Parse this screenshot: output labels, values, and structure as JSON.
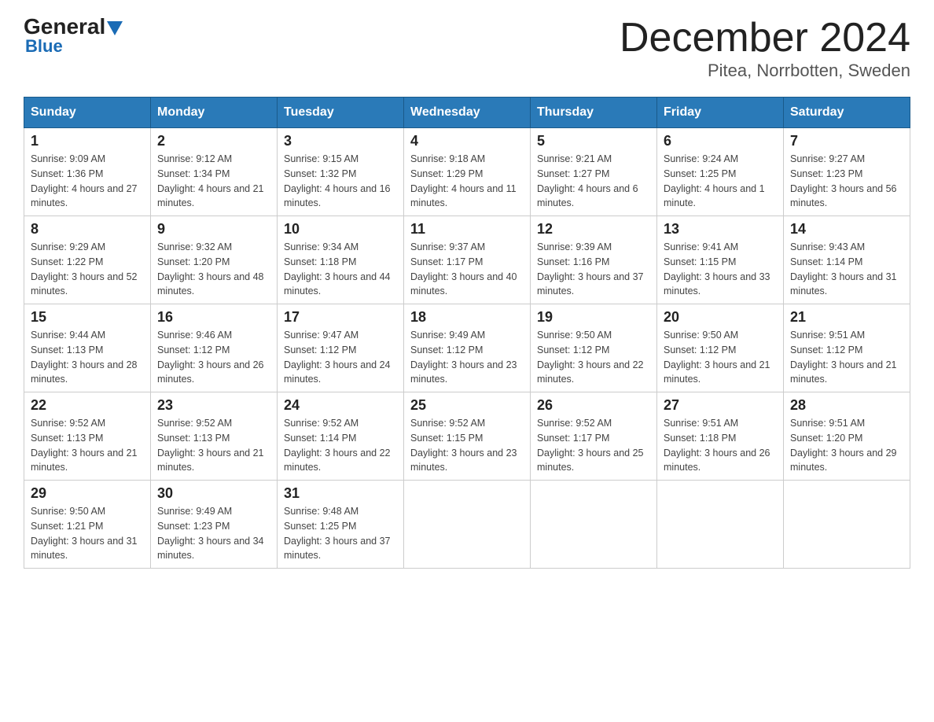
{
  "header": {
    "logo_general": "General",
    "logo_blue": "Blue",
    "main_title": "December 2024",
    "subtitle": "Pitea, Norrbotten, Sweden"
  },
  "days_of_week": [
    "Sunday",
    "Monday",
    "Tuesday",
    "Wednesday",
    "Thursday",
    "Friday",
    "Saturday"
  ],
  "weeks": [
    [
      {
        "day": "1",
        "sunrise": "9:09 AM",
        "sunset": "1:36 PM",
        "daylight": "4 hours and 27 minutes."
      },
      {
        "day": "2",
        "sunrise": "9:12 AM",
        "sunset": "1:34 PM",
        "daylight": "4 hours and 21 minutes."
      },
      {
        "day": "3",
        "sunrise": "9:15 AM",
        "sunset": "1:32 PM",
        "daylight": "4 hours and 16 minutes."
      },
      {
        "day": "4",
        "sunrise": "9:18 AM",
        "sunset": "1:29 PM",
        "daylight": "4 hours and 11 minutes."
      },
      {
        "day": "5",
        "sunrise": "9:21 AM",
        "sunset": "1:27 PM",
        "daylight": "4 hours and 6 minutes."
      },
      {
        "day": "6",
        "sunrise": "9:24 AM",
        "sunset": "1:25 PM",
        "daylight": "4 hours and 1 minute."
      },
      {
        "day": "7",
        "sunrise": "9:27 AM",
        "sunset": "1:23 PM",
        "daylight": "3 hours and 56 minutes."
      }
    ],
    [
      {
        "day": "8",
        "sunrise": "9:29 AM",
        "sunset": "1:22 PM",
        "daylight": "3 hours and 52 minutes."
      },
      {
        "day": "9",
        "sunrise": "9:32 AM",
        "sunset": "1:20 PM",
        "daylight": "3 hours and 48 minutes."
      },
      {
        "day": "10",
        "sunrise": "9:34 AM",
        "sunset": "1:18 PM",
        "daylight": "3 hours and 44 minutes."
      },
      {
        "day": "11",
        "sunrise": "9:37 AM",
        "sunset": "1:17 PM",
        "daylight": "3 hours and 40 minutes."
      },
      {
        "day": "12",
        "sunrise": "9:39 AM",
        "sunset": "1:16 PM",
        "daylight": "3 hours and 37 minutes."
      },
      {
        "day": "13",
        "sunrise": "9:41 AM",
        "sunset": "1:15 PM",
        "daylight": "3 hours and 33 minutes."
      },
      {
        "day": "14",
        "sunrise": "9:43 AM",
        "sunset": "1:14 PM",
        "daylight": "3 hours and 31 minutes."
      }
    ],
    [
      {
        "day": "15",
        "sunrise": "9:44 AM",
        "sunset": "1:13 PM",
        "daylight": "3 hours and 28 minutes."
      },
      {
        "day": "16",
        "sunrise": "9:46 AM",
        "sunset": "1:12 PM",
        "daylight": "3 hours and 26 minutes."
      },
      {
        "day": "17",
        "sunrise": "9:47 AM",
        "sunset": "1:12 PM",
        "daylight": "3 hours and 24 minutes."
      },
      {
        "day": "18",
        "sunrise": "9:49 AM",
        "sunset": "1:12 PM",
        "daylight": "3 hours and 23 minutes."
      },
      {
        "day": "19",
        "sunrise": "9:50 AM",
        "sunset": "1:12 PM",
        "daylight": "3 hours and 22 minutes."
      },
      {
        "day": "20",
        "sunrise": "9:50 AM",
        "sunset": "1:12 PM",
        "daylight": "3 hours and 21 minutes."
      },
      {
        "day": "21",
        "sunrise": "9:51 AM",
        "sunset": "1:12 PM",
        "daylight": "3 hours and 21 minutes."
      }
    ],
    [
      {
        "day": "22",
        "sunrise": "9:52 AM",
        "sunset": "1:13 PM",
        "daylight": "3 hours and 21 minutes."
      },
      {
        "day": "23",
        "sunrise": "9:52 AM",
        "sunset": "1:13 PM",
        "daylight": "3 hours and 21 minutes."
      },
      {
        "day": "24",
        "sunrise": "9:52 AM",
        "sunset": "1:14 PM",
        "daylight": "3 hours and 22 minutes."
      },
      {
        "day": "25",
        "sunrise": "9:52 AM",
        "sunset": "1:15 PM",
        "daylight": "3 hours and 23 minutes."
      },
      {
        "day": "26",
        "sunrise": "9:52 AM",
        "sunset": "1:17 PM",
        "daylight": "3 hours and 25 minutes."
      },
      {
        "day": "27",
        "sunrise": "9:51 AM",
        "sunset": "1:18 PM",
        "daylight": "3 hours and 26 minutes."
      },
      {
        "day": "28",
        "sunrise": "9:51 AM",
        "sunset": "1:20 PM",
        "daylight": "3 hours and 29 minutes."
      }
    ],
    [
      {
        "day": "29",
        "sunrise": "9:50 AM",
        "sunset": "1:21 PM",
        "daylight": "3 hours and 31 minutes."
      },
      {
        "day": "30",
        "sunrise": "9:49 AM",
        "sunset": "1:23 PM",
        "daylight": "3 hours and 34 minutes."
      },
      {
        "day": "31",
        "sunrise": "9:48 AM",
        "sunset": "1:25 PM",
        "daylight": "3 hours and 37 minutes."
      },
      null,
      null,
      null,
      null
    ]
  ]
}
